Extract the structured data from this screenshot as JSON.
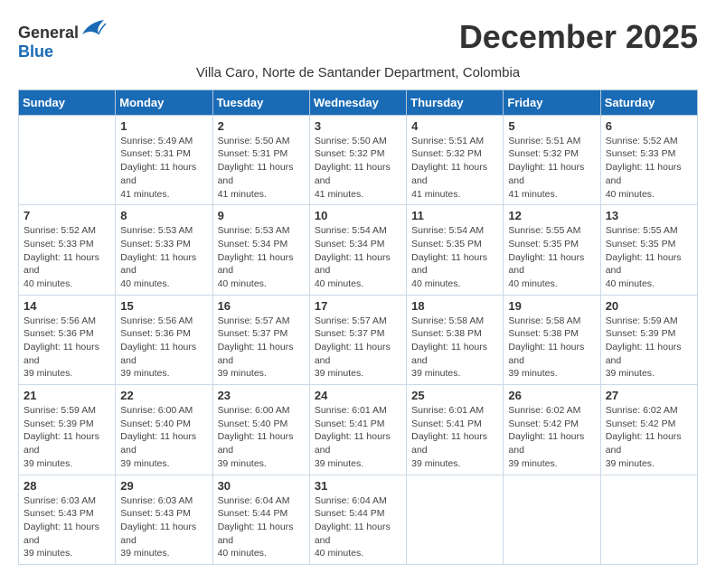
{
  "logo": {
    "general": "General",
    "blue": "Blue"
  },
  "title": "December 2025",
  "subtitle": "Villa Caro, Norte de Santander Department, Colombia",
  "days_of_week": [
    "Sunday",
    "Monday",
    "Tuesday",
    "Wednesday",
    "Thursday",
    "Friday",
    "Saturday"
  ],
  "weeks": [
    [
      {
        "day": "",
        "sunrise": "",
        "sunset": "",
        "daylight": ""
      },
      {
        "day": "1",
        "sunrise": "Sunrise: 5:49 AM",
        "sunset": "Sunset: 5:31 PM",
        "daylight": "Daylight: 11 hours and 41 minutes."
      },
      {
        "day": "2",
        "sunrise": "Sunrise: 5:50 AM",
        "sunset": "Sunset: 5:31 PM",
        "daylight": "Daylight: 11 hours and 41 minutes."
      },
      {
        "day": "3",
        "sunrise": "Sunrise: 5:50 AM",
        "sunset": "Sunset: 5:32 PM",
        "daylight": "Daylight: 11 hours and 41 minutes."
      },
      {
        "day": "4",
        "sunrise": "Sunrise: 5:51 AM",
        "sunset": "Sunset: 5:32 PM",
        "daylight": "Daylight: 11 hours and 41 minutes."
      },
      {
        "day": "5",
        "sunrise": "Sunrise: 5:51 AM",
        "sunset": "Sunset: 5:32 PM",
        "daylight": "Daylight: 11 hours and 41 minutes."
      },
      {
        "day": "6",
        "sunrise": "Sunrise: 5:52 AM",
        "sunset": "Sunset: 5:33 PM",
        "daylight": "Daylight: 11 hours and 40 minutes."
      }
    ],
    [
      {
        "day": "7",
        "sunrise": "Sunrise: 5:52 AM",
        "sunset": "Sunset: 5:33 PM",
        "daylight": "Daylight: 11 hours and 40 minutes."
      },
      {
        "day": "8",
        "sunrise": "Sunrise: 5:53 AM",
        "sunset": "Sunset: 5:33 PM",
        "daylight": "Daylight: 11 hours and 40 minutes."
      },
      {
        "day": "9",
        "sunrise": "Sunrise: 5:53 AM",
        "sunset": "Sunset: 5:34 PM",
        "daylight": "Daylight: 11 hours and 40 minutes."
      },
      {
        "day": "10",
        "sunrise": "Sunrise: 5:54 AM",
        "sunset": "Sunset: 5:34 PM",
        "daylight": "Daylight: 11 hours and 40 minutes."
      },
      {
        "day": "11",
        "sunrise": "Sunrise: 5:54 AM",
        "sunset": "Sunset: 5:35 PM",
        "daylight": "Daylight: 11 hours and 40 minutes."
      },
      {
        "day": "12",
        "sunrise": "Sunrise: 5:55 AM",
        "sunset": "Sunset: 5:35 PM",
        "daylight": "Daylight: 11 hours and 40 minutes."
      },
      {
        "day": "13",
        "sunrise": "Sunrise: 5:55 AM",
        "sunset": "Sunset: 5:35 PM",
        "daylight": "Daylight: 11 hours and 40 minutes."
      }
    ],
    [
      {
        "day": "14",
        "sunrise": "Sunrise: 5:56 AM",
        "sunset": "Sunset: 5:36 PM",
        "daylight": "Daylight: 11 hours and 39 minutes."
      },
      {
        "day": "15",
        "sunrise": "Sunrise: 5:56 AM",
        "sunset": "Sunset: 5:36 PM",
        "daylight": "Daylight: 11 hours and 39 minutes."
      },
      {
        "day": "16",
        "sunrise": "Sunrise: 5:57 AM",
        "sunset": "Sunset: 5:37 PM",
        "daylight": "Daylight: 11 hours and 39 minutes."
      },
      {
        "day": "17",
        "sunrise": "Sunrise: 5:57 AM",
        "sunset": "Sunset: 5:37 PM",
        "daylight": "Daylight: 11 hours and 39 minutes."
      },
      {
        "day": "18",
        "sunrise": "Sunrise: 5:58 AM",
        "sunset": "Sunset: 5:38 PM",
        "daylight": "Daylight: 11 hours and 39 minutes."
      },
      {
        "day": "19",
        "sunrise": "Sunrise: 5:58 AM",
        "sunset": "Sunset: 5:38 PM",
        "daylight": "Daylight: 11 hours and 39 minutes."
      },
      {
        "day": "20",
        "sunrise": "Sunrise: 5:59 AM",
        "sunset": "Sunset: 5:39 PM",
        "daylight": "Daylight: 11 hours and 39 minutes."
      }
    ],
    [
      {
        "day": "21",
        "sunrise": "Sunrise: 5:59 AM",
        "sunset": "Sunset: 5:39 PM",
        "daylight": "Daylight: 11 hours and 39 minutes."
      },
      {
        "day": "22",
        "sunrise": "Sunrise: 6:00 AM",
        "sunset": "Sunset: 5:40 PM",
        "daylight": "Daylight: 11 hours and 39 minutes."
      },
      {
        "day": "23",
        "sunrise": "Sunrise: 6:00 AM",
        "sunset": "Sunset: 5:40 PM",
        "daylight": "Daylight: 11 hours and 39 minutes."
      },
      {
        "day": "24",
        "sunrise": "Sunrise: 6:01 AM",
        "sunset": "Sunset: 5:41 PM",
        "daylight": "Daylight: 11 hours and 39 minutes."
      },
      {
        "day": "25",
        "sunrise": "Sunrise: 6:01 AM",
        "sunset": "Sunset: 5:41 PM",
        "daylight": "Daylight: 11 hours and 39 minutes."
      },
      {
        "day": "26",
        "sunrise": "Sunrise: 6:02 AM",
        "sunset": "Sunset: 5:42 PM",
        "daylight": "Daylight: 11 hours and 39 minutes."
      },
      {
        "day": "27",
        "sunrise": "Sunrise: 6:02 AM",
        "sunset": "Sunset: 5:42 PM",
        "daylight": "Daylight: 11 hours and 39 minutes."
      }
    ],
    [
      {
        "day": "28",
        "sunrise": "Sunrise: 6:03 AM",
        "sunset": "Sunset: 5:43 PM",
        "daylight": "Daylight: 11 hours and 39 minutes."
      },
      {
        "day": "29",
        "sunrise": "Sunrise: 6:03 AM",
        "sunset": "Sunset: 5:43 PM",
        "daylight": "Daylight: 11 hours and 39 minutes."
      },
      {
        "day": "30",
        "sunrise": "Sunrise: 6:04 AM",
        "sunset": "Sunset: 5:44 PM",
        "daylight": "Daylight: 11 hours and 40 minutes."
      },
      {
        "day": "31",
        "sunrise": "Sunrise: 6:04 AM",
        "sunset": "Sunset: 5:44 PM",
        "daylight": "Daylight: 11 hours and 40 minutes."
      },
      {
        "day": "",
        "sunrise": "",
        "sunset": "",
        "daylight": ""
      },
      {
        "day": "",
        "sunrise": "",
        "sunset": "",
        "daylight": ""
      },
      {
        "day": "",
        "sunrise": "",
        "sunset": "",
        "daylight": ""
      }
    ]
  ]
}
